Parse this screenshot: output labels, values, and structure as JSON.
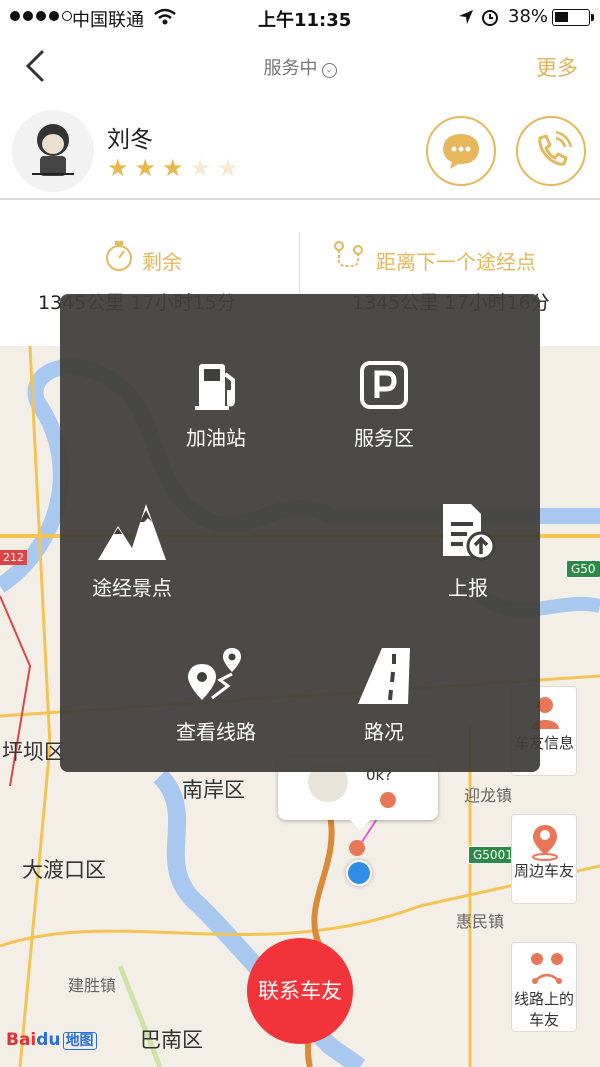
{
  "status_bar": {
    "carrier": "中国联通",
    "time": "上午11:35",
    "battery": "38%"
  },
  "nav": {
    "title": "服务中",
    "more": "更多"
  },
  "driver": {
    "name": "刘冬",
    "rating": 3,
    "rating_max": 5
  },
  "info": {
    "remaining_label": "剩余",
    "remaining_value": "1345公里 17小时15分",
    "next_waypoint_label": "距离下一个途经点",
    "next_waypoint_value": "1345公里 17小时16分"
  },
  "menu": {
    "items": [
      {
        "label": "加油站",
        "icon": "gas-station-icon"
      },
      {
        "label": "服务区",
        "icon": "parking-icon"
      },
      {
        "label": "途经景点",
        "icon": "mountain-icon"
      },
      {
        "label": "上报",
        "icon": "report-upload-icon"
      },
      {
        "label": "查看线路",
        "icon": "route-icon"
      },
      {
        "label": "路况",
        "icon": "road-icon"
      }
    ]
  },
  "map": {
    "places": [
      "坪坝区",
      "南岸区",
      "迎龙镇",
      "大渡口区",
      "惠民镇",
      "建胜镇",
      "巴南区"
    ],
    "road_labels": [
      "212",
      "G50",
      "G5001"
    ],
    "bubble_text": "0k?",
    "side_buttons": [
      {
        "label": "车友信息",
        "icon": "person-icon"
      },
      {
        "label": "周边车友",
        "icon": "location-person-icon"
      },
      {
        "label": "线路上的车友",
        "icon": "route-people-icon"
      }
    ],
    "contact_button": "联系车友",
    "logo": "Baidu地图"
  },
  "colors": {
    "accent": "#e6b75b",
    "contact": "#f0343a",
    "overlay": "#413f3c"
  }
}
